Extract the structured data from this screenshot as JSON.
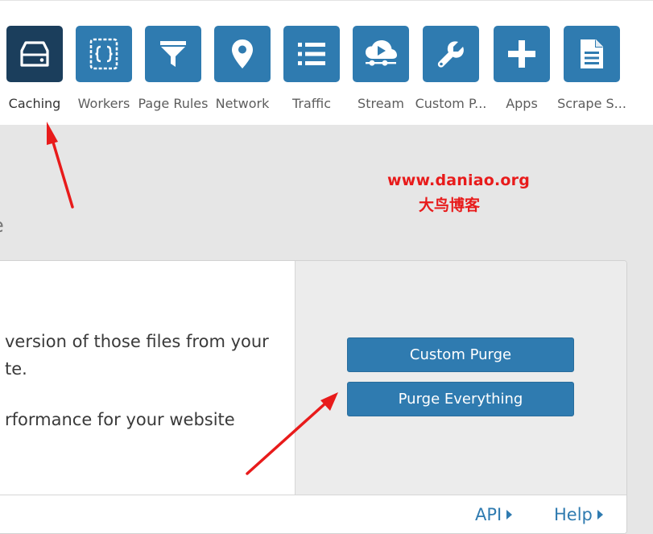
{
  "nav": {
    "items": [
      {
        "label": "Caching",
        "icon": "server-drive-icon",
        "active": true
      },
      {
        "label": "Workers",
        "icon": "code-braces-icon",
        "active": false
      },
      {
        "label": "Page Rules",
        "icon": "filter-funnel-icon",
        "active": false
      },
      {
        "label": "Network",
        "icon": "map-pin-icon",
        "active": false
      },
      {
        "label": "Traffic",
        "icon": "list-icon",
        "active": false
      },
      {
        "label": "Stream",
        "icon": "cloud-play-icon",
        "active": false
      },
      {
        "label": "Custom P...",
        "icon": "wrench-icon",
        "active": false
      },
      {
        "label": "Apps",
        "icon": "plus-icon",
        "active": false
      },
      {
        "label": "Scrape S...",
        "icon": "document-icon",
        "active": false
      }
    ]
  },
  "watermark": {
    "url": "www.daniao.org",
    "name_cn": "大鸟博客"
  },
  "partial_heading": "e",
  "card": {
    "desc_line1": "version of those files from your",
    "desc_line2": "te.",
    "desc_line3": "rformance for your website",
    "custom_purge_label": "Custom Purge",
    "purge_everything_label": "Purge Everything",
    "api_label": "API",
    "help_label": "Help"
  },
  "colors": {
    "tile_blue": "#2f7bb0",
    "tile_active": "#1b3e5c",
    "annotation_red": "#e81b1b"
  }
}
